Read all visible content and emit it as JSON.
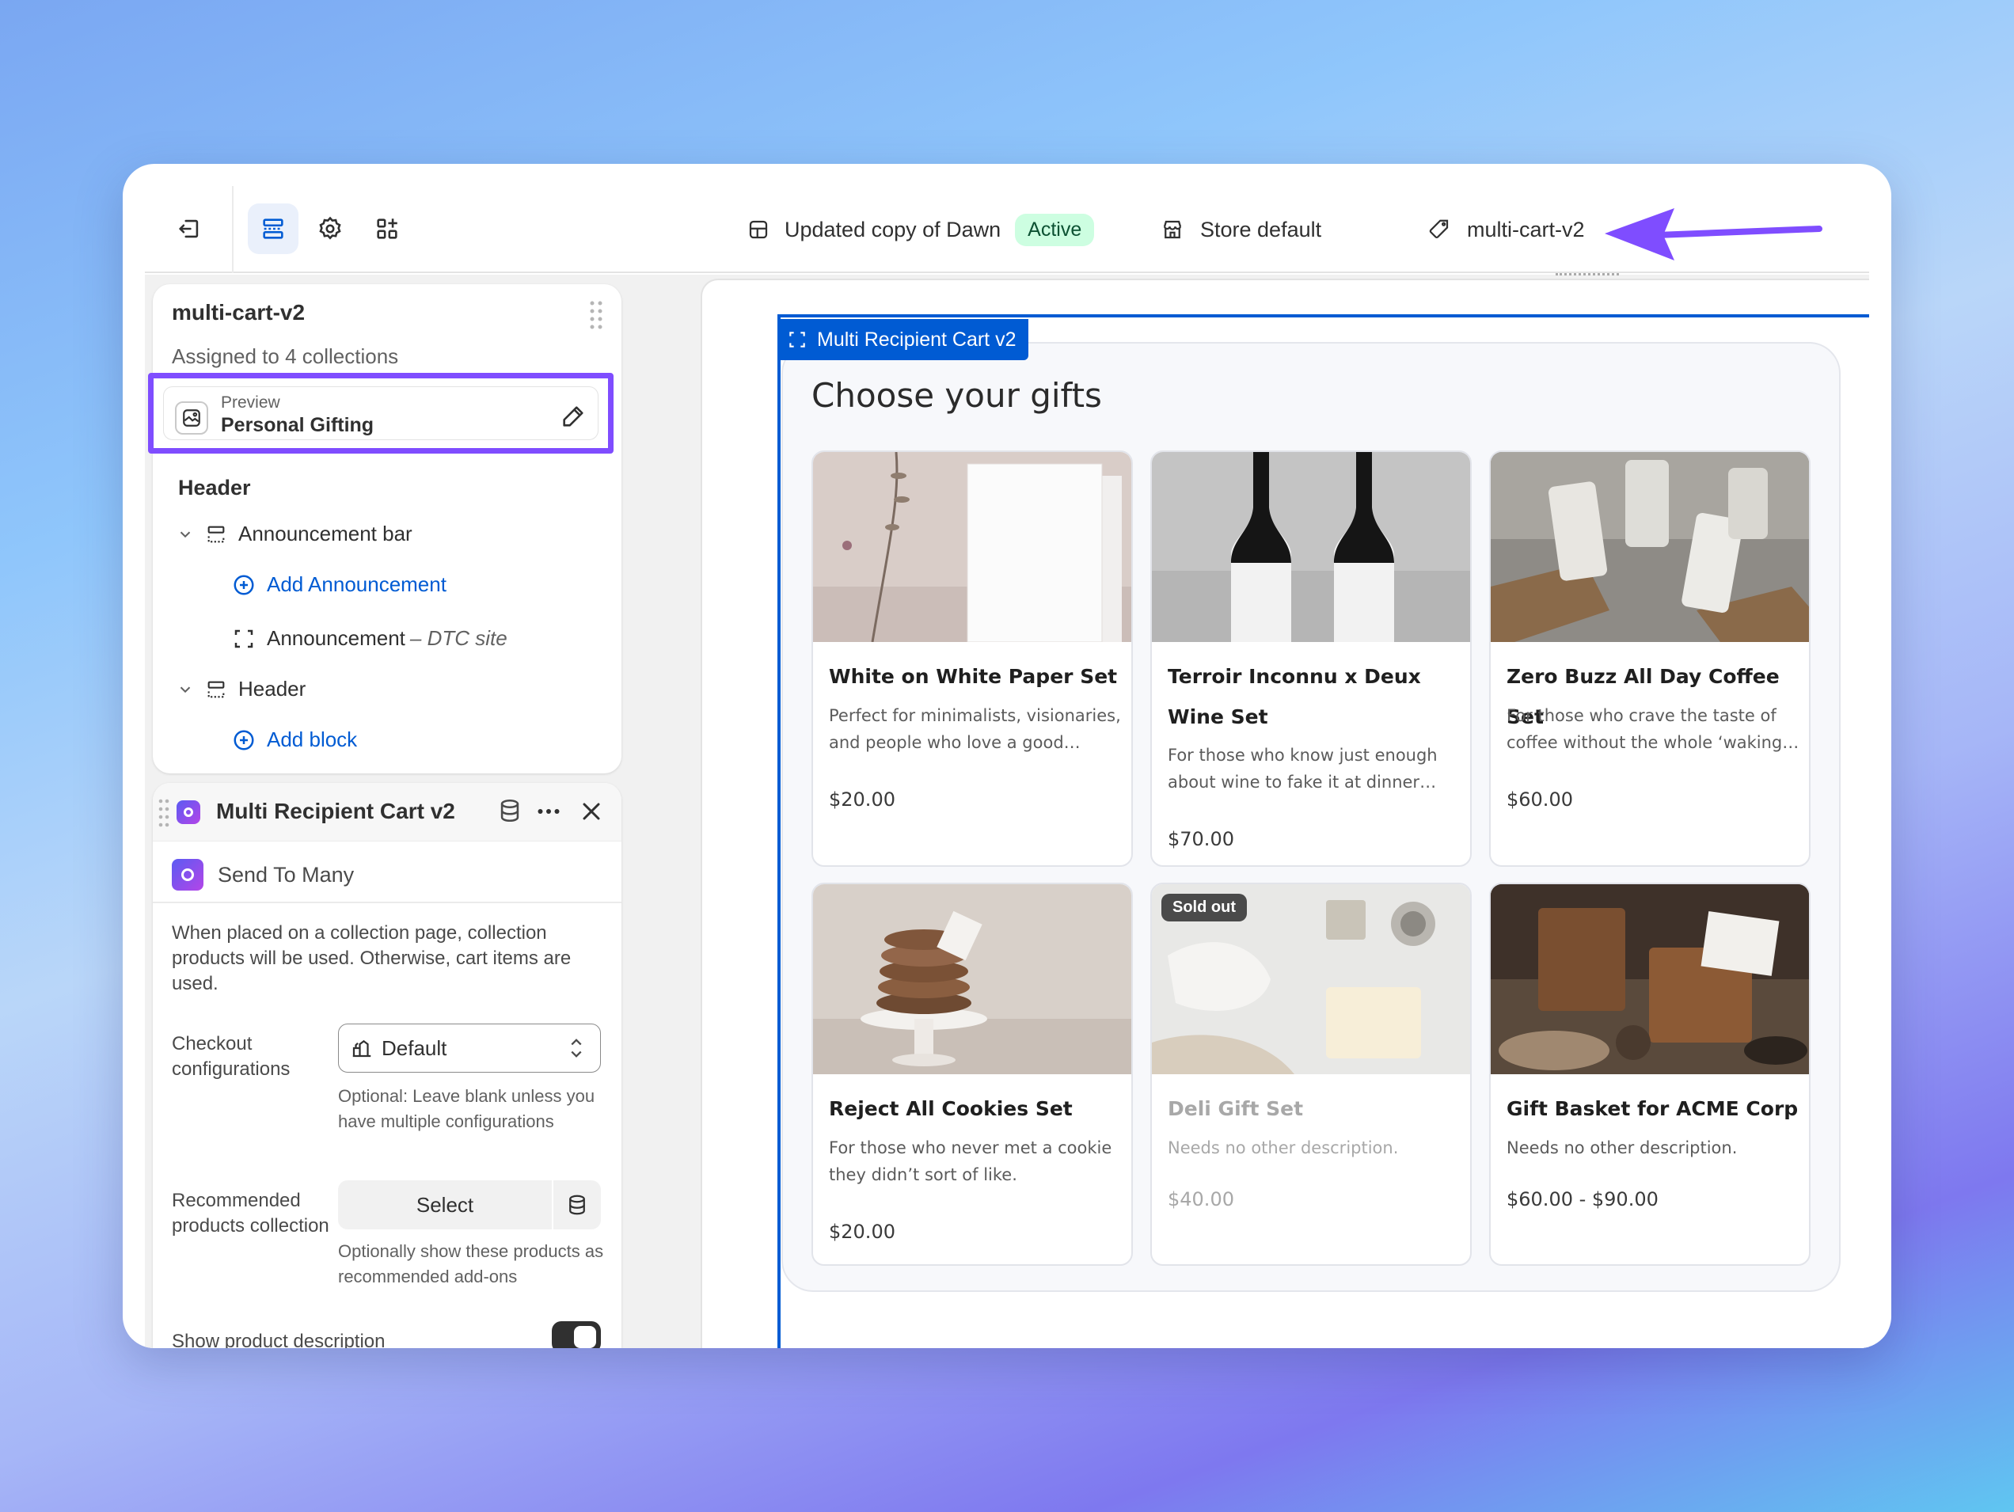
{
  "topbar": {
    "theme_name": "Updated copy of Dawn",
    "theme_status": "Active",
    "store": "Store default",
    "template": "multi-cart-v2",
    "icons": [
      "exit-icon",
      "sections-icon",
      "settings-icon",
      "apps-icon",
      "theme-icon",
      "store-icon",
      "tag-icon"
    ],
    "annotation_color": "#7f4dff"
  },
  "template_card": {
    "title": "multi-cart-v2",
    "subtitle": "Assigned to 4 collections",
    "preview_label": "Preview",
    "preview_value": "Personal Gifting",
    "group_heading": "Header",
    "tree": {
      "announcement_bar": "Announcement bar",
      "add_announcement": "Add Announcement",
      "announcement": "Announcement",
      "announcement_note": "– DTC site",
      "header": "Header",
      "add_block": "Add block"
    }
  },
  "block_panel": {
    "title": "Multi Recipient Cart v2",
    "app_name": "Send To Many",
    "description": "When placed on a collection page, collection products will be used. Otherwise, cart items are used.",
    "checkout_label": "Checkout configurations",
    "checkout_value": "Default",
    "checkout_help": "Optional: Leave blank unless you have multiple configurations",
    "recommended_label": "Recommended products collection",
    "select_button": "Select",
    "recommended_help": "Optionally show these products as recommended add-ons",
    "show_desc_label": "Show product description",
    "show_desc_on": true
  },
  "preview": {
    "section_tag": "Multi Recipient Cart v2",
    "heading": "Choose your gifts",
    "selection_color": "#005bd3",
    "products": [
      {
        "name": "White on White Paper Set",
        "desc": "Perfect for minimalists, visionaries, and people who love a good…",
        "price": "$20.00",
        "sold_out": false
      },
      {
        "name": "Terroir Inconnu x Deux Wine Set",
        "desc": "For those who know just enough about wine to fake it at dinner…",
        "price": "$70.00",
        "sold_out": false
      },
      {
        "name": "Zero Buzz All Day Coffee Set",
        "desc": "For those who crave the taste of coffee without the whole ‘waking…",
        "price": "$60.00",
        "sold_out": false
      },
      {
        "name": "Reject All Cookies Set",
        "desc": "For those who never met a cookie they didn’t sort of like.",
        "price": "$20.00",
        "sold_out": false
      },
      {
        "name": "Deli Gift Set",
        "desc": "Needs no other description.",
        "price": "$40.00",
        "sold_out": true,
        "badge": "Sold out"
      },
      {
        "name": "Gift Basket for ACME Corp",
        "desc": "Needs no other description.",
        "price": "$60.00 - $90.00",
        "sold_out": false
      }
    ]
  }
}
